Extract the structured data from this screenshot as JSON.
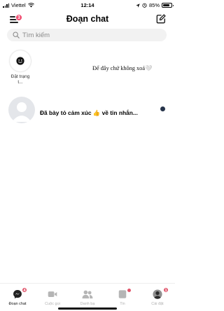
{
  "status_bar": {
    "carrier": "Viettel",
    "time": "12:14",
    "battery": "85%",
    "battery_level": 0.85
  },
  "header": {
    "title": "Đoạn chat",
    "menu_badge": "3"
  },
  "search": {
    "placeholder": "Tìm kiếm"
  },
  "stories": {
    "own_label": "Đặt trạng t...",
    "note_text": "Để đây chứ không xoá🤍"
  },
  "chats": [
    {
      "preview": "Đã bày tỏ cảm xúc 👍 về tin nhắn...",
      "unread": true
    }
  ],
  "tabs": [
    {
      "label": "Đoạn chat",
      "icon": "chat-bubble-icon",
      "badge": "4",
      "active": true
    },
    {
      "label": "Cuộc gọi",
      "icon": "video-camera-icon",
      "badge": "",
      "active": false
    },
    {
      "label": "Danh bạ",
      "icon": "people-icon",
      "badge": "",
      "active": false
    },
    {
      "label": "Tin",
      "icon": "stories-icon",
      "badge": "",
      "active": false
    },
    {
      "label": "Cài đặt",
      "icon": "profile-avatar-icon",
      "badge": "1",
      "active": false
    }
  ],
  "colors": {
    "badge": "#f0466b",
    "unread_dot": "#26344a",
    "search_bg": "#f2f2f2"
  }
}
